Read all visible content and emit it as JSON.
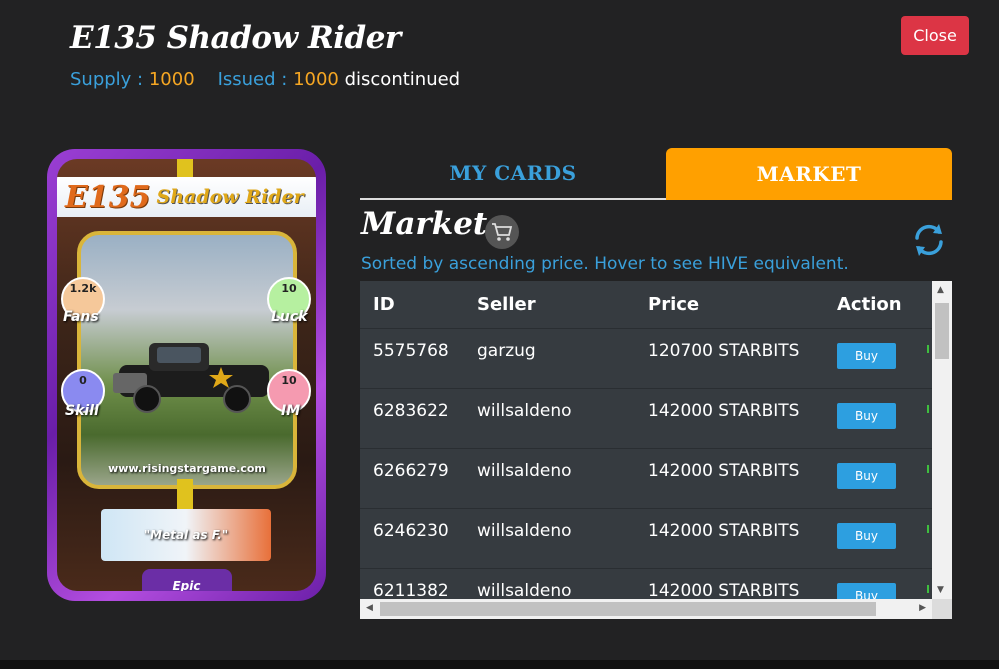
{
  "header": {
    "title": "E135 Shadow Rider",
    "supply_label": "Supply :",
    "supply_value": "1000",
    "issued_label": "Issued :",
    "issued_value": "1000",
    "status": "discontinued",
    "close_label": "Close"
  },
  "card": {
    "code": "E135",
    "name": "Shadow Rider",
    "stats": {
      "fans_value": "1.2k",
      "fans_label": "Fans",
      "luck_value": "10",
      "luck_label": "Luck",
      "skill_value": "0",
      "skill_label": "Skill",
      "im_value": "10",
      "im_label": "IM"
    },
    "website": "www.risingstargame.com",
    "quote": "\"Metal as F.\"",
    "rarity": "Epic"
  },
  "tabs": [
    {
      "label": "MY CARDS",
      "active": false
    },
    {
      "label": "MARKET",
      "active": true
    }
  ],
  "market": {
    "title": "Market",
    "subtitle": "Sorted by ascending price. Hover to see HIVE equivalent.",
    "columns": [
      "ID",
      "Seller",
      "Price",
      "Action"
    ],
    "buy_label": "Buy",
    "rows": [
      {
        "id": "5575768",
        "seller": "garzug",
        "price": "120700 STARBITS"
      },
      {
        "id": "6283622",
        "seller": "willsaldeno",
        "price": "142000 STARBITS"
      },
      {
        "id": "6266279",
        "seller": "willsaldeno",
        "price": "142000 STARBITS"
      },
      {
        "id": "6246230",
        "seller": "willsaldeno",
        "price": "142000 STARBITS"
      },
      {
        "id": "6211382",
        "seller": "willsaldeno",
        "price": "142000 STARBITS"
      }
    ]
  },
  "colors": {
    "accent_blue": "#3aa0db",
    "accent_orange": "#ffa000",
    "close_red": "#dc3545",
    "buy_blue": "#2d9fe0"
  }
}
